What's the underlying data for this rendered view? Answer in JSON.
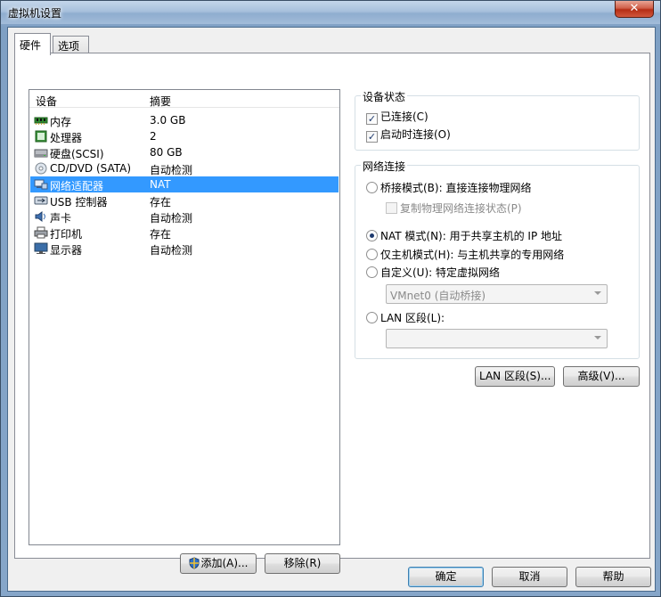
{
  "window": {
    "title": "虚拟机设置",
    "close_glyph": "✕"
  },
  "tabs": [
    {
      "label": "硬件",
      "active": true
    },
    {
      "label": "选项",
      "active": false
    }
  ],
  "device_list": {
    "headers": {
      "device": "设备",
      "summary": "摘要"
    },
    "items": [
      {
        "name": "内存",
        "summary": "3.0 GB",
        "icon": "memory-icon"
      },
      {
        "name": "处理器",
        "summary": "2",
        "icon": "processor-icon"
      },
      {
        "name": "硬盘(SCSI)",
        "summary": "80 GB",
        "icon": "hard-disk-icon"
      },
      {
        "name": "CD/DVD (SATA)",
        "summary": "自动检测",
        "icon": "cd-dvd-icon"
      },
      {
        "name": "网络适配器",
        "summary": "NAT",
        "icon": "network-adapter-icon",
        "selected": true
      },
      {
        "name": "USB 控制器",
        "summary": "存在",
        "icon": "usb-icon"
      },
      {
        "name": "声卡",
        "summary": "自动检测",
        "icon": "sound-card-icon"
      },
      {
        "name": "打印机",
        "summary": "存在",
        "icon": "printer-icon"
      },
      {
        "name": "显示器",
        "summary": "自动检测",
        "icon": "display-icon"
      }
    ],
    "add_button": "添加(A)...",
    "remove_button": "移除(R)"
  },
  "device_status": {
    "label": "设备状态",
    "connected": {
      "label": "已连接(C)",
      "checked": true
    },
    "connect_at_power_on": {
      "label": "启动时连接(O)",
      "checked": true
    }
  },
  "network_connection": {
    "label": "网络连接",
    "bridged": {
      "label": "桥接模式(B): 直接连接物理网络",
      "selected": false
    },
    "replicate": {
      "label": "复制物理网络连接状态(P)",
      "checked": false,
      "disabled": true
    },
    "nat": {
      "label": "NAT 模式(N): 用于共享主机的 IP 地址",
      "selected": true
    },
    "host_only": {
      "label": "仅主机模式(H): 与主机共享的专用网络",
      "selected": false
    },
    "custom": {
      "label": "自定义(U): 特定虚拟网络",
      "selected": false
    },
    "custom_value": "VMnet0 (自动桥接)",
    "lan_segment": {
      "label": "LAN 区段(L):",
      "selected": false
    },
    "lan_segment_value": ""
  },
  "lan_segments_button": "LAN 区段(S)...",
  "advanced_button": "高级(V)...",
  "footer": {
    "ok": "确定",
    "cancel": "取消",
    "help": "帮助"
  },
  "colors": {
    "selection": "#3399ff",
    "close_button": "#c7432a"
  }
}
